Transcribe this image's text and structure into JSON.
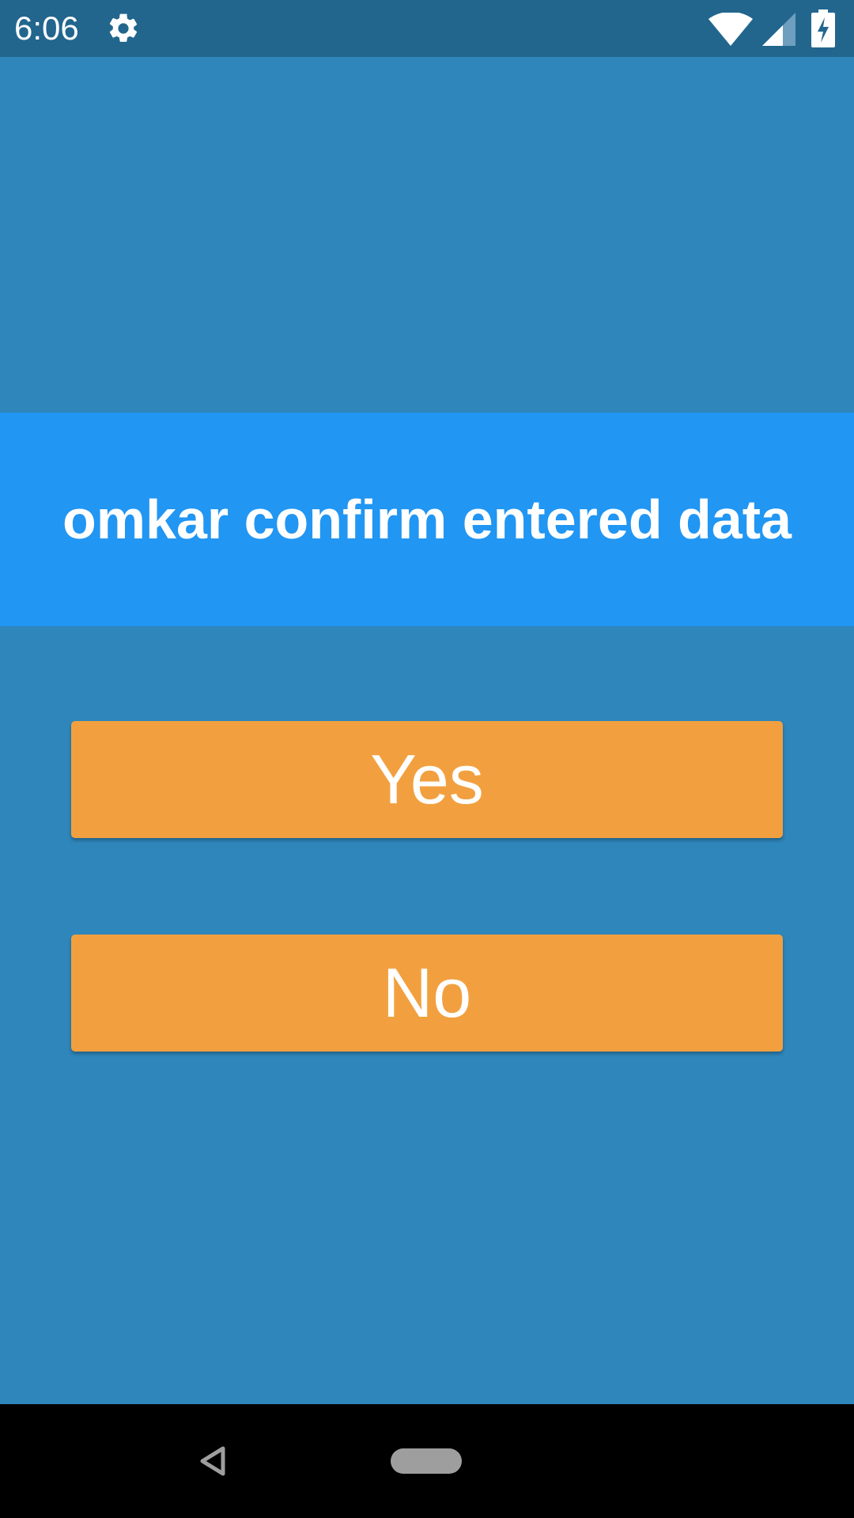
{
  "status_bar": {
    "time": "6:06",
    "icons": [
      "gear-icon",
      "wifi-icon",
      "signal-icon",
      "battery-charging-icon"
    ],
    "color": "#22668e"
  },
  "screen": {
    "background_color": "#2e86bb",
    "title": "omkar confirm entered data",
    "title_band_color": "#2196f3"
  },
  "buttons": {
    "yes_label": "Yes",
    "no_label": "No",
    "color": "#f2a03f"
  },
  "nav_bar": {
    "icons": [
      "back-icon",
      "home-pill-icon"
    ]
  }
}
